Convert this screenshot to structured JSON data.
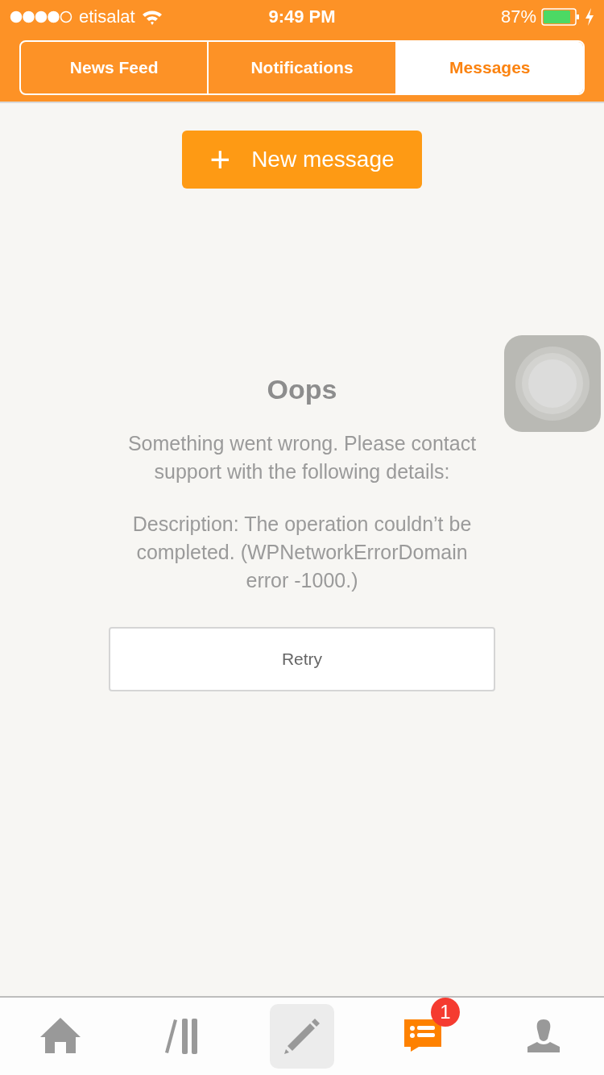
{
  "status_bar": {
    "carrier": "etisalat",
    "time": "9:49 PM",
    "battery": "87%"
  },
  "tabs": [
    {
      "label": "News Feed",
      "selected": false
    },
    {
      "label": "Notifications",
      "selected": false
    },
    {
      "label": "Messages",
      "selected": true
    }
  ],
  "new_message_button": {
    "icon": "+",
    "label": "New message"
  },
  "error": {
    "title": "Oops",
    "message": "Something went wrong. Please contact support with the following details:",
    "description": "Description: The operation couldn’t be completed. (WPNetworkErrorDomain error -1000.)",
    "retry": "Retry"
  },
  "tab_bar": [
    {
      "kind": "home",
      "selected": false
    },
    {
      "kind": "reader",
      "selected": false
    },
    {
      "kind": "write",
      "selected": false
    },
    {
      "kind": "notifications",
      "selected": true,
      "badge": "1"
    },
    {
      "kind": "me",
      "selected": false
    }
  ]
}
